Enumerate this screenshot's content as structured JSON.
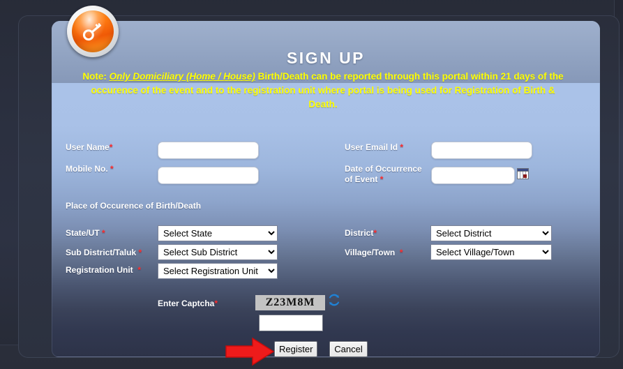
{
  "header": {
    "title": "SIGN UP",
    "badge_icon": "key-icon"
  },
  "note": {
    "prefix": "Note: ",
    "emphasis": "Only Domiciliary (Home / House)",
    "rest": " Birth/Death can be reported through this portal within 21 days of the occurence of the event and to the registration unit where portal is being used for Registration of Birth & Death."
  },
  "form": {
    "required_mark": "*",
    "user_name": {
      "label": "User Name",
      "value": "",
      "placeholder": ""
    },
    "mobile_no": {
      "label": "Mobile No.",
      "value": "",
      "placeholder": ""
    },
    "user_email": {
      "label": "User Email Id",
      "value": "",
      "placeholder": ""
    },
    "date_of_occurrence": {
      "label_line1": "Date of Occurrence",
      "label_line2": "of Event",
      "value": "",
      "placeholder": "",
      "icon": "calendar-icon"
    },
    "section_heading": "Place of Occurence of Birth/Death",
    "state": {
      "label": "State/UT",
      "selected": "Select State",
      "options": [
        "Select State"
      ]
    },
    "district": {
      "label": "District",
      "selected": "Select District",
      "options": [
        "Select District"
      ]
    },
    "sub_district": {
      "label": "Sub District/Taluk",
      "selected": "Select Sub District",
      "options": [
        "Select Sub District"
      ]
    },
    "village_town": {
      "label": "Village/Town",
      "selected": "Select Village/Town",
      "options": [
        "Select Village/Town"
      ]
    },
    "registration_unit": {
      "label": "Registration Unit",
      "selected": "Select Registration Unit",
      "options": [
        "Select Registration Unit"
      ]
    },
    "captcha": {
      "label": "Enter Captcha",
      "code": "Z23M8M",
      "input_value": "",
      "refresh_icon": "refresh-icon"
    }
  },
  "actions": {
    "register": "Register",
    "cancel": "Cancel",
    "pointer_icon": "red-arrow-icon"
  },
  "colors": {
    "note_text": "#ffff00",
    "required": "#ff2d2d",
    "panel_header": "#94a6c4",
    "panel_body_top": "#aac2e8",
    "panel_body_bottom": "#2d3348",
    "badge_orange": "#ff7a10",
    "captcha_bg": "#c3c3c3",
    "arrow_red": "#ee1b1b"
  }
}
